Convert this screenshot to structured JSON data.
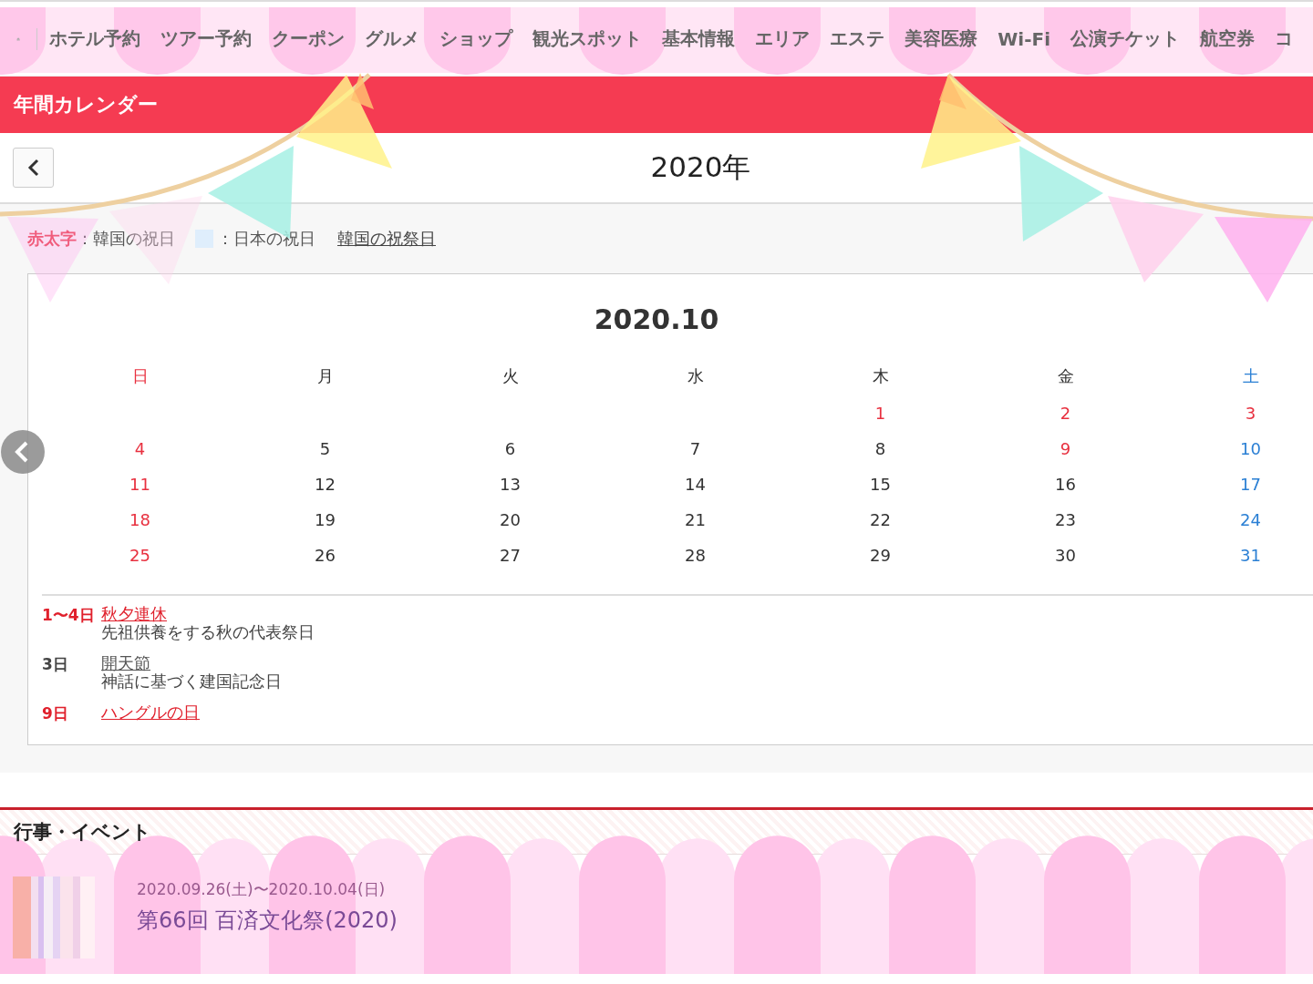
{
  "nav": {
    "items": [
      "ホテル予約",
      "ツアー予約",
      "クーポン",
      "グルメ",
      "ショップ",
      "観光スポット",
      "基本情報",
      "エリア",
      "エステ",
      "美容医療",
      "Wi-Fi",
      "公演チケット",
      "航空券",
      "コ"
    ]
  },
  "page_title": "年間カレンダー",
  "year": "2020年",
  "legend": {
    "red_label": "赤太字",
    "red_text": "：韓国の祝日",
    "japan_text": "：日本の祝日",
    "link": "韓国の祝祭日"
  },
  "calendar": {
    "title": "2020.10",
    "weekdays": [
      {
        "label": "日",
        "kind": "sunday"
      },
      {
        "label": "月",
        "kind": "weekday"
      },
      {
        "label": "火",
        "kind": "weekday"
      },
      {
        "label": "水",
        "kind": "weekday"
      },
      {
        "label": "木",
        "kind": "weekday"
      },
      {
        "label": "金",
        "kind": "weekday"
      },
      {
        "label": "土",
        "kind": "saturday"
      }
    ],
    "weeks": [
      [
        {
          "day": "1",
          "kind": "holiday"
        },
        {
          "day": "2",
          "kind": "holiday"
        },
        {
          "day": "3",
          "kind": "holiday"
        }
      ],
      [
        {
          "day": "4",
          "kind": "sunday"
        },
        {
          "day": "5",
          "kind": "weekday"
        },
        {
          "day": "6",
          "kind": "weekday"
        },
        {
          "day": "7",
          "kind": "weekday"
        },
        {
          "day": "8",
          "kind": "weekday"
        },
        {
          "day": "9",
          "kind": "holiday"
        },
        {
          "day": "10",
          "kind": "saturday"
        }
      ],
      [
        {
          "day": "11",
          "kind": "sunday"
        },
        {
          "day": "12",
          "kind": "weekday"
        },
        {
          "day": "13",
          "kind": "weekday"
        },
        {
          "day": "14",
          "kind": "weekday"
        },
        {
          "day": "15",
          "kind": "weekday"
        },
        {
          "day": "16",
          "kind": "weekday"
        },
        {
          "day": "17",
          "kind": "saturday"
        }
      ],
      [
        {
          "day": "18",
          "kind": "sunday"
        },
        {
          "day": "19",
          "kind": "weekday"
        },
        {
          "day": "20",
          "kind": "weekday"
        },
        {
          "day": "21",
          "kind": "weekday"
        },
        {
          "day": "22",
          "kind": "weekday"
        },
        {
          "day": "23",
          "kind": "weekday"
        },
        {
          "day": "24",
          "kind": "saturday"
        }
      ],
      [
        {
          "day": "25",
          "kind": "sunday"
        },
        {
          "day": "26",
          "kind": "weekday"
        },
        {
          "day": "27",
          "kind": "weekday"
        },
        {
          "day": "28",
          "kind": "weekday"
        },
        {
          "day": "29",
          "kind": "weekday"
        },
        {
          "day": "30",
          "kind": "weekday"
        },
        {
          "day": "31",
          "kind": "saturday"
        }
      ]
    ]
  },
  "holidays": [
    {
      "date": "1〜4日",
      "kind": "korean",
      "title": "秋夕連休",
      "note": "先祖供養をする秋の代表祭日"
    },
    {
      "date": "3日",
      "kind": "other",
      "title": "開天節",
      "note": "神話に基づく建国記念日"
    },
    {
      "date": "9日",
      "kind": "korean",
      "title": "ハングルの日"
    }
  ],
  "event_section": {
    "title": "行事・イベント",
    "items": [
      {
        "date": "2020.09.26(土)〜2020.10.04(日)",
        "title": "第66回 百済文化祭(2020)"
      }
    ]
  }
}
